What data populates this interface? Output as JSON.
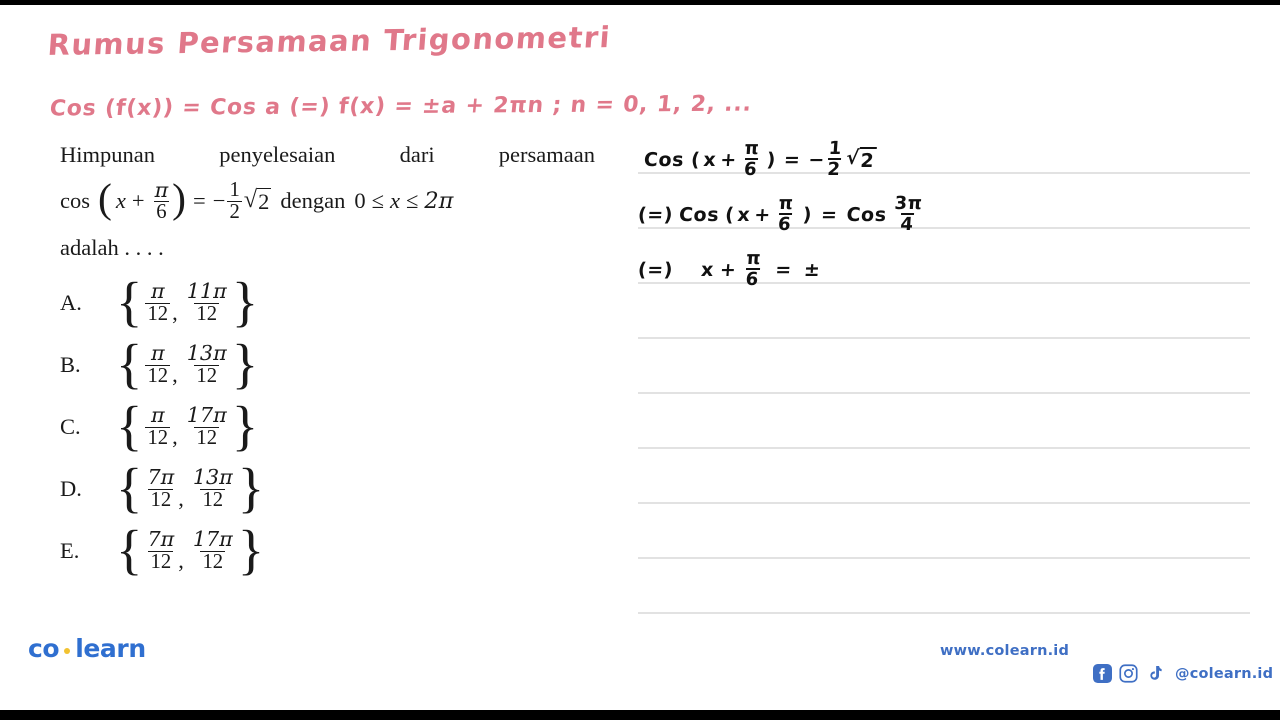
{
  "page": {
    "handwritten_title": "Rumus Persamaan Trigonometri",
    "handwritten_formula": "Cos (f(x)) = Cos a (=) f(x) = ±a + 2πn ; n = 0, 1, 2, ..."
  },
  "question": {
    "line1": "Himpunan penyelesaian dari persamaan",
    "equation": {
      "cos": "cos",
      "open_paren": "(",
      "var": "x",
      "plus": "+",
      "frac_num": "π",
      "frac_den": "6",
      "close_paren": ")",
      "equals": "=",
      "minus": "−",
      "half_num": "1",
      "half_den": "2",
      "sqrt_sign": "√",
      "sqrt_radicand": "2",
      "dengan": "dengan",
      "domain_lower": "0",
      "le1": "≤",
      "domain_var": "x",
      "le2": "≤",
      "domain_upper": "2π"
    },
    "line3": "adalah . . . ."
  },
  "options": [
    {
      "label": "A.",
      "open": "{",
      "n1": "π",
      "d1": "12",
      "sep": ",",
      "n2": "11π",
      "d2": "12",
      "close": "}"
    },
    {
      "label": "B.",
      "open": "{",
      "n1": "π",
      "d1": "12",
      "sep": ",",
      "n2": "13π",
      "d2": "12",
      "close": "}"
    },
    {
      "label": "C.",
      "open": "{",
      "n1": "π",
      "d1": "12",
      "sep": ",",
      "n2": "17π",
      "d2": "12",
      "close": "}"
    },
    {
      "label": "D.",
      "open": "{",
      "n1": "7π",
      "d1": "12",
      "sep": ",",
      "n2": "13π",
      "d2": "12",
      "close": "}"
    },
    {
      "label": "E.",
      "open": "{",
      "n1": "7π",
      "d1": "12",
      "sep": ",",
      "n2": "17π",
      "d2": "12",
      "close": "}"
    }
  ],
  "notes": {
    "line1": {
      "cos": "Cos",
      "open": "(",
      "var": "x",
      "plus": "+",
      "num": "π",
      "den": "6",
      "close": ")",
      "eq": "=",
      "minus": "−",
      "hnum": "1",
      "hden": "2",
      "sqrt": "√",
      "rad": "2"
    },
    "line2": {
      "imp": "(=)",
      "cos": "Cos",
      "open": "(",
      "var": "x",
      "plus": "+",
      "num": "π",
      "den": "6",
      "close": ")",
      "eq": "=",
      "cos2": "Cos",
      "rnum": "3π",
      "rden": "4"
    },
    "line3": {
      "imp": "(=)",
      "var": "x",
      "plus": "+",
      "num": "π",
      "den": "6",
      "eq": "=",
      "pm": "±"
    }
  },
  "footer": {
    "logo_left": "co",
    "logo_right": "learn",
    "website": "www.colearn.id",
    "handle": "@colearn.id",
    "icons": [
      "facebook-icon",
      "instagram-icon",
      "tiktok-icon"
    ],
    "brand_blue": "#2f6fd0",
    "accent_yellow": "#f2c230",
    "ink_pink": "#e0788a"
  }
}
